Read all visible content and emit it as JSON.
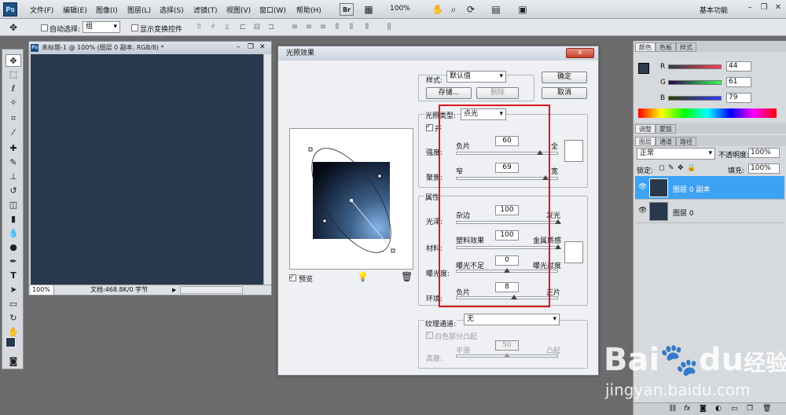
{
  "app": {
    "logo": "Ps",
    "workspace": "基本功能"
  },
  "menus": [
    "文件(F)",
    "编辑(E)",
    "图像(I)",
    "图层(L)",
    "选择(S)",
    "滤镜(T)",
    "视图(V)",
    "窗口(W)",
    "帮助(H)"
  ],
  "menubar_tools": {
    "br_label": "Br",
    "zoom_level": "100%"
  },
  "options_bar": {
    "auto_select_label": "自动选择:",
    "auto_select_value": "组",
    "show_transform_label": "显示变换控件"
  },
  "document": {
    "title": "未标题-1 @ 100% (图层 0 副本, RGB/8) *",
    "zoom": "100%",
    "status": "文档:468.8K/0 字节",
    "canvas_color": "#28384d"
  },
  "dialog": {
    "title": "光照效果",
    "close_label": "x",
    "style_label": "样式:",
    "style_value": "默认值",
    "ok_label": "确定",
    "cancel_label": "取消",
    "save_label": "存储...",
    "delete_label": "删除",
    "light_type_label": "光照类型:",
    "light_type_value": "点光",
    "on_label": "开",
    "intensity_label": "强度:",
    "intensity_left": "负片",
    "intensity_value": "60",
    "intensity_right": "全",
    "focus_label": "聚焦:",
    "focus_left": "窄",
    "focus_value": "69",
    "focus_right": "宽",
    "properties_label": "属性",
    "gloss_label": "光泽:",
    "gloss_left": "杂边",
    "gloss_value": "100",
    "gloss_right": "发光",
    "material_label": "材料:",
    "material_left": "塑料效果",
    "material_value": "100",
    "material_right": "金属质感",
    "exposure_label": "曝光度:",
    "exposure_left": "曝光不足",
    "exposure_value": "0",
    "exposure_right": "曝光过度",
    "ambience_label": "环境:",
    "ambience_left": "负片",
    "ambience_value": "8",
    "ambience_right": "正片",
    "texture_label": "纹理通道:",
    "texture_value": "无",
    "white_high_label": "白色部分凸起",
    "height_label": "高度:",
    "height_left": "平滑",
    "height_value": "50",
    "height_right": "凸起",
    "preview_label": "预览"
  },
  "color_panel": {
    "tabs": [
      "颜色",
      "色板",
      "样式"
    ],
    "r_label": "R",
    "r_value": "44",
    "g_label": "G",
    "g_value": "61",
    "b_label": "B",
    "b_value": "79"
  },
  "adjust_tabs": [
    "调整",
    "蒙版"
  ],
  "layers_panel": {
    "tabs": [
      "图层",
      "通道",
      "路径"
    ],
    "blend_mode": "正常",
    "opacity_label": "不透明度:",
    "opacity_value": "100%",
    "lock_label": "锁定:",
    "fill_label": "填充:",
    "fill_value": "100%",
    "layers": [
      {
        "name": "图层 0 副本",
        "selected": true
      },
      {
        "name": "图层 0",
        "selected": false
      }
    ]
  },
  "watermark": {
    "brand": "Bai",
    "brand2": "du",
    "brand3": "经验",
    "url": "jingyan.baidu.com"
  }
}
